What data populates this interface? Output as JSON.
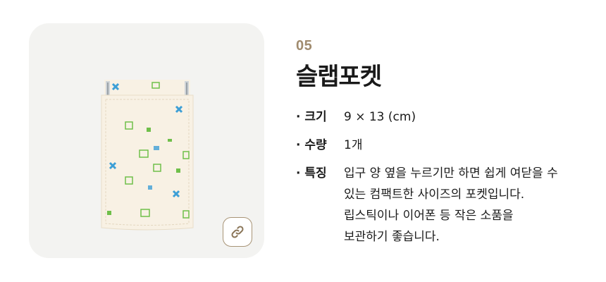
{
  "product": {
    "number": "05",
    "title": "슬랩포켓"
  },
  "specs": [
    {
      "key": "· 크기",
      "lines": [
        "9 × 13 (cm)"
      ]
    },
    {
      "key": "· 수량",
      "lines": [
        "1개"
      ]
    },
    {
      "key": "· 특징",
      "lines": [
        "입구 양 옆을 누르기만 하면 쉽게 여닫을 수",
        "있는 컴팩트한 사이즈의 포켓입니다.",
        "립스틱이나 이어폰 등 작은 소품을",
        "보관하기 좋습니다."
      ]
    }
  ],
  "icons": {
    "link": "link-icon"
  },
  "colors": {
    "accent": "#a08b6e",
    "card_background": "#f3f3f1",
    "pouch_body": "#f8f1e4",
    "pattern_blue": "#3d9fd6",
    "pattern_green": "#6fbf4a"
  }
}
